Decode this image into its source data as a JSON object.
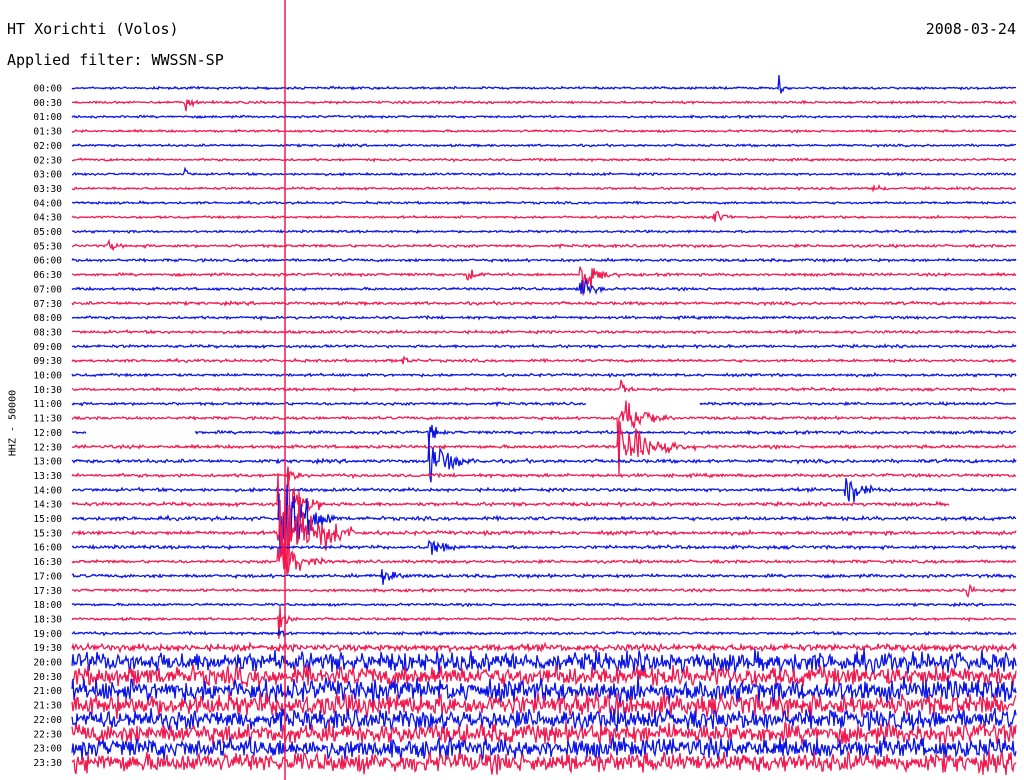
{
  "header": {
    "station": "HT Xorichti (Volos)",
    "date": "2008-03-24",
    "filter_text": "Applied filter: WWSSN-SP"
  },
  "chart_data": {
    "type": "line",
    "title": "HT Xorichti (Volos)",
    "subtitle": "Applied filter: WWSSN-SP",
    "ylabel": "HHZ - 50000",
    "xlabel": "",
    "colors": {
      "even_trace": "#0a14e6",
      "odd_trace": "#f2194e"
    },
    "categories": [
      "00:00",
      "00:30",
      "01:00",
      "01:30",
      "02:00",
      "02:30",
      "03:00",
      "03:30",
      "04:00",
      "04:30",
      "05:00",
      "05:30",
      "06:00",
      "06:30",
      "07:00",
      "07:30",
      "08:00",
      "08:30",
      "09:00",
      "09:30",
      "10:00",
      "10:30",
      "11:00",
      "11:30",
      "12:00",
      "12:30",
      "13:00",
      "13:30",
      "14:00",
      "14:30",
      "15:00",
      "15:30",
      "16:00",
      "16:30",
      "17:00",
      "17:30",
      "18:00",
      "18:30",
      "19:00",
      "19:30",
      "20:00",
      "20:30",
      "21:00",
      "21:30",
      "22:00",
      "22:30",
      "23:00",
      "23:30"
    ],
    "noise_level": [
      1,
      1,
      1,
      1,
      1,
      1,
      1,
      1,
      1,
      1,
      1,
      1.2,
      1.2,
      1.2,
      1.2,
      1.3,
      1.2,
      1.2,
      1.2,
      1.2,
      1.2,
      1.2,
      1.2,
      1.2,
      1.3,
      1.4,
      1.5,
      1.4,
      1.4,
      1.5,
      1.6,
      1.6,
      1.4,
      1.3,
      1.4,
      1.2,
      1.1,
      1.1,
      1.2,
      3,
      9,
      9,
      10,
      10,
      9,
      9,
      9,
      9
    ],
    "events": [
      {
        "trace": "00:00",
        "at": 0.75,
        "amp": 10,
        "dur": 0.01
      },
      {
        "trace": "00:30",
        "at": 0.12,
        "amp": 8,
        "dur": 0.02
      },
      {
        "trace": "03:00",
        "at": 0.12,
        "amp": 8,
        "dur": 0.01
      },
      {
        "trace": "03:30",
        "at": 0.85,
        "amp": 4,
        "dur": 0.03
      },
      {
        "trace": "04:30",
        "at": 0.68,
        "amp": 7,
        "dur": 0.03
      },
      {
        "trace": "05:30",
        "at": 0.04,
        "amp": 6,
        "dur": 0.02
      },
      {
        "trace": "06:30",
        "at": 0.54,
        "amp": 20,
        "dur": 0.04
      },
      {
        "trace": "06:30",
        "at": 0.42,
        "amp": 8,
        "dur": 0.02
      },
      {
        "trace": "07:00",
        "at": 0.54,
        "amp": 14,
        "dur": 0.03
      },
      {
        "trace": "09:30",
        "at": 0.35,
        "amp": 6,
        "dur": 0.02
      },
      {
        "trace": "10:30",
        "at": 0.58,
        "amp": 12,
        "dur": 0.02
      },
      {
        "trace": "11:30",
        "at": 0.58,
        "amp": 22,
        "dur": 0.06
      },
      {
        "trace": "12:00",
        "at": 0.38,
        "amp": 10,
        "dur": 0.02
      },
      {
        "trace": "12:30",
        "at": 0.58,
        "amp": 30,
        "dur": 0.08
      },
      {
        "trace": "13:00",
        "at": 0.38,
        "amp": 20,
        "dur": 0.06
      },
      {
        "trace": "13:30",
        "at": 0.23,
        "amp": 8,
        "dur": 0.02
      },
      {
        "trace": "14:00",
        "at": 0.82,
        "amp": 18,
        "dur": 0.04
      },
      {
        "trace": "14:30",
        "at": 0.22,
        "amp": 40,
        "dur": 0.05
      },
      {
        "trace": "15:00",
        "at": 0.22,
        "amp": 60,
        "dur": 0.06
      },
      {
        "trace": "15:30",
        "at": 0.22,
        "amp": 70,
        "dur": 0.08
      },
      {
        "trace": "16:00",
        "at": 0.38,
        "amp": 8,
        "dur": 0.04
      },
      {
        "trace": "16:30",
        "at": 0.22,
        "amp": 25,
        "dur": 0.05
      },
      {
        "trace": "17:00",
        "at": 0.33,
        "amp": 8,
        "dur": 0.04
      },
      {
        "trace": "17:30",
        "at": 0.95,
        "amp": 8,
        "dur": 0.01
      },
      {
        "trace": "18:30",
        "at": 0.22,
        "amp": 15,
        "dur": 0.02
      },
      {
        "trace": "19:00",
        "at": 0.22,
        "amp": 10,
        "dur": 0.02
      }
    ],
    "gaps": [
      {
        "trace": "11:00",
        "from": 0.545,
        "to": 0.665
      },
      {
        "trace": "12:00",
        "from": 0.015,
        "to": 0.13
      },
      {
        "trace": "14:30",
        "from": 0.93,
        "to": 1.0
      }
    ]
  }
}
